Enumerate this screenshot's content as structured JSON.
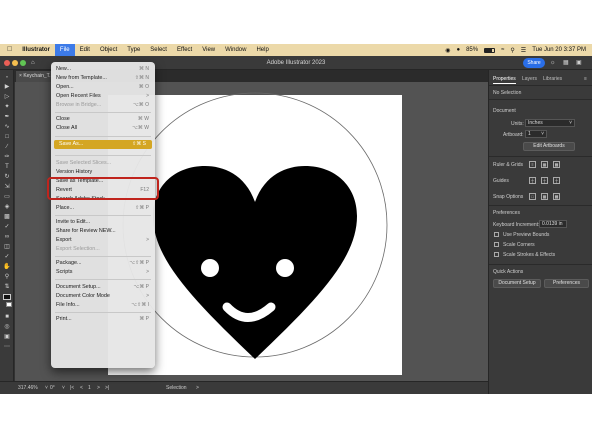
{
  "menubar": {
    "app_name": "Illustrator",
    "items": [
      "File",
      "Edit",
      "Object",
      "Type",
      "Select",
      "Effect",
      "View",
      "Window",
      "Help"
    ],
    "battery": "85%",
    "datetime": "Tue Jun 20  3:37 PM"
  },
  "appbar": {
    "title": "Adobe Illustrator 2023",
    "share_label": "Share"
  },
  "document": {
    "tab_name": "Keychain_T..."
  },
  "status": {
    "zoom": "317.46%",
    "rotation": "0°",
    "artboard_num": "1",
    "tool": "Selection"
  },
  "panel": {
    "tabs": [
      "Properties",
      "Layers",
      "Libraries"
    ],
    "no_selection": "No Selection",
    "document_label": "Document",
    "units_label": "Units:",
    "units_value": "Inches",
    "artboard_label": "Artboard:",
    "artboard_value": "1",
    "edit_artboards": "Edit Artboards",
    "ruler_grids": "Ruler & Grids",
    "guides": "Guides",
    "snap_options": "Snap Options",
    "preferences_label": "Preferences",
    "keyboard_increment_label": "Keyboard Increment:",
    "keyboard_increment_value": "0.0139 in",
    "use_preview_bounds": "Use Preview Bounds",
    "scale_corners": "Scale Corners",
    "scale_strokes": "Scale Strokes & Effects",
    "quick_actions": "Quick Actions",
    "document_setup_btn": "Document Setup",
    "preferences_btn": "Preferences"
  },
  "file_menu": {
    "items": [
      {
        "label": "New...",
        "shortcut": "⌘ N"
      },
      {
        "label": "New from Template...",
        "shortcut": "⇧⌘ N"
      },
      {
        "label": "Open...",
        "shortcut": "⌘ O"
      },
      {
        "label": "Open Recent Files",
        "shortcut": ">"
      },
      {
        "label": "Browse in Bridge...",
        "shortcut": "⌥⌘ O"
      },
      {
        "label": "Close",
        "shortcut": "⌘ W"
      },
      {
        "label": "Close All",
        "shortcut": "⌥⌘ W"
      },
      {
        "label": "Save As...",
        "shortcut": "⇧⌘ S"
      },
      {
        "label": "Save Selected Slices...",
        "shortcut": ""
      },
      {
        "label": "Version History",
        "shortcut": ""
      },
      {
        "label": "Save as Template...",
        "shortcut": ""
      },
      {
        "label": "Revert",
        "shortcut": "F12"
      },
      {
        "label": "Search Adobe Stock...",
        "shortcut": ""
      },
      {
        "label": "Place...",
        "shortcut": "⇧⌘ P"
      },
      {
        "label": "Invite to Edit...",
        "shortcut": ""
      },
      {
        "label": "Share for Review NEW...",
        "shortcut": ""
      },
      {
        "label": "Export",
        "shortcut": ">"
      },
      {
        "label": "Export Selection...",
        "shortcut": ""
      },
      {
        "label": "Package...",
        "shortcut": "⌥⇧⌘ P"
      },
      {
        "label": "Scripts",
        "shortcut": ">"
      },
      {
        "label": "Document Setup...",
        "shortcut": "⌥⌘ P"
      },
      {
        "label": "Document Color Mode",
        "shortcut": ">"
      },
      {
        "label": "File Info...",
        "shortcut": "⌥⇧⌘ I"
      },
      {
        "label": "Print...",
        "shortcut": "⌘ P"
      }
    ]
  },
  "colors": {
    "menubar_bg": "#ecd9a9",
    "highlight": "#d4a623",
    "callout_red": "#c0241d",
    "share_blue": "#2a6ee8"
  }
}
